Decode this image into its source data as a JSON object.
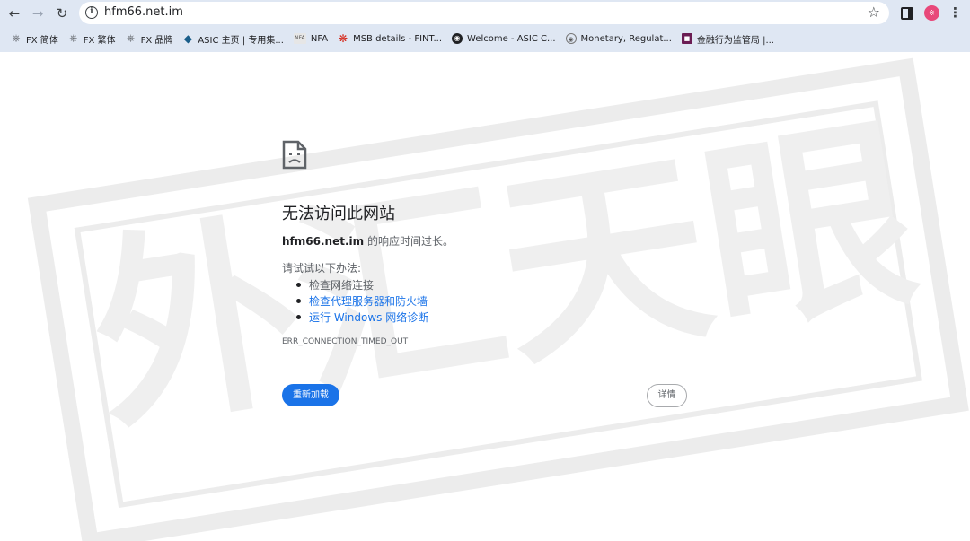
{
  "browser": {
    "url": "hfm66.net.im",
    "avatar_text": "※",
    "icons": [
      "back-icon",
      "forward-icon",
      "reload-icon",
      "info-icon",
      "star-icon",
      "side-panel-icon",
      "menu-icon"
    ]
  },
  "bookmarks": [
    {
      "label": "FX 简体",
      "icon": "fx-icon"
    },
    {
      "label": "FX 繁体",
      "icon": "fx-icon"
    },
    {
      "label": "FX 品牌",
      "icon": "fx-icon"
    },
    {
      "label": "ASIC 主页 | 专用集...",
      "icon": "asic-icon"
    },
    {
      "label": "NFA",
      "icon": "nfa-icon"
    },
    {
      "label": "MSB details - FINT...",
      "icon": "maple-leaf-icon"
    },
    {
      "label": "Welcome - ASIC C...",
      "icon": "globe-icon"
    },
    {
      "label": "Monetary, Regulat...",
      "icon": "seal-icon"
    },
    {
      "label": "金融行为监管局 |...",
      "icon": "jp-icon"
    }
  ],
  "error": {
    "title": "无法访问此网站",
    "host": "hfm66.net.im",
    "message": " 的响应时间过长。",
    "try_title": "请试试以下办法:",
    "suggestions": [
      {
        "text": "检查网络连接",
        "link": false
      },
      {
        "text": "检查代理服务器和防火墙",
        "link": true
      },
      {
        "text": "运行 Windows 网络诊断",
        "link": true
      }
    ],
    "code": "ERR_CONNECTION_TIMED_OUT",
    "reload_label": "重新加载",
    "details_label": "详情"
  },
  "watermark": {
    "text": "外汇天眼",
    "color": "#ebebeb"
  },
  "colors": {
    "chrome_bg": "#dfe7f3",
    "accent": "#1a73e8",
    "avatar": "#e8487a"
  }
}
